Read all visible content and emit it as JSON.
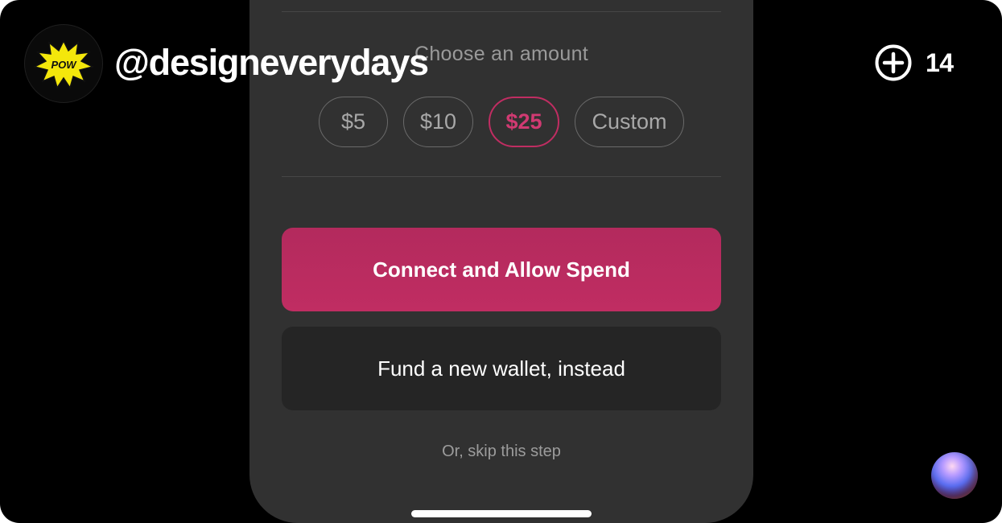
{
  "overlay": {
    "handle": "@designeverydays",
    "avatar_text": "POW",
    "add_count": "14",
    "icons": {
      "add": "plus-circle-icon",
      "orb": "sphere-orb-icon"
    }
  },
  "amount_section": {
    "title": "Choose an amount",
    "options": [
      {
        "label": "$5",
        "selected": false
      },
      {
        "label": "$10",
        "selected": false
      },
      {
        "label": "$25",
        "selected": true
      },
      {
        "label": "Custom",
        "selected": false
      }
    ]
  },
  "actions": {
    "primary_label": "Connect and Allow Spend",
    "secondary_label": "Fund a new wallet, instead",
    "skip_label": "Or, skip this step"
  },
  "colors": {
    "accent": "#c02d62",
    "panel": "#313131",
    "secondary_button": "#252525",
    "background": "#000000"
  }
}
